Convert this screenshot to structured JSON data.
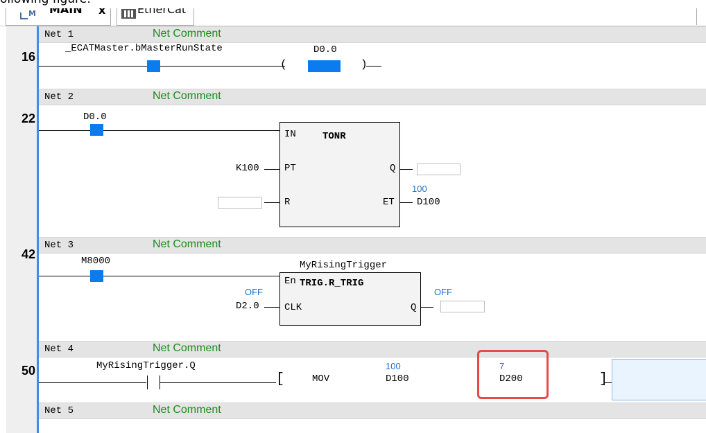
{
  "caption": "ollowing figure:",
  "tabs": [
    {
      "label": "MAIN",
      "close": "x"
    },
    {
      "label": "EtherCat"
    }
  ],
  "networks": [
    {
      "label": "Net 1",
      "comment": "Net Comment",
      "line": "16",
      "contact_var": "_ECATMaster.bMasterRunState",
      "coil_var": "D0.0"
    },
    {
      "label": "Net 2",
      "comment": "Net Comment",
      "line": "22",
      "contact_var": "D0.0",
      "block_type": "TONR",
      "pin_in": "IN",
      "pin_pt": "PT",
      "pin_r": "R",
      "pin_q": "Q",
      "pin_et": "ET",
      "pt_value": "K100",
      "et_value": "100",
      "et_var": "D100"
    },
    {
      "label": "Net 3",
      "comment": "Net Comment",
      "line": "42",
      "contact_var": "M8000",
      "instance": "MyRisingTrigger",
      "block_type": "TRIG.R_TRIG",
      "pin_en": "En",
      "pin_clk": "CLK",
      "pin_q": "Q",
      "clk_value": "OFF",
      "clk_var": "D2.0",
      "q_value": "OFF"
    },
    {
      "label": "Net 4",
      "comment": "Net Comment",
      "line": "50",
      "contact_var": "MyRisingTrigger.Q",
      "instr": "MOV",
      "src_value": "100",
      "src_var": "D100",
      "dst_value": "7",
      "dst_var": "D200",
      "left_bracket": "[",
      "right_bracket": "]"
    },
    {
      "label": "Net 5",
      "comment": "Net Comment"
    }
  ],
  "colors": {
    "accent": "#0a7cf0",
    "comment": "#1a8a1a",
    "highlight": "#e64a4a",
    "value": "#1b6fd1"
  }
}
